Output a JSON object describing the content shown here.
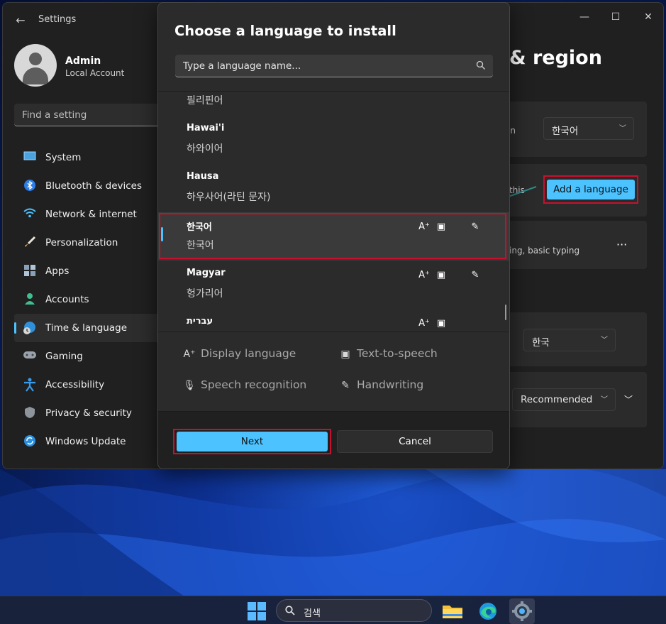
{
  "settings": {
    "app_title": "Settings",
    "profile": {
      "name": "Admin",
      "account_type": "Local Account"
    },
    "search_placeholder": "Find a setting",
    "nav": [
      {
        "label": "System",
        "icon": "monitor-icon"
      },
      {
        "label": "Bluetooth & devices",
        "icon": "bluetooth-icon"
      },
      {
        "label": "Network & internet",
        "icon": "wifi-icon"
      },
      {
        "label": "Personalization",
        "icon": "brush-icon"
      },
      {
        "label": "Apps",
        "icon": "apps-icon"
      },
      {
        "label": "Accounts",
        "icon": "person-icon"
      },
      {
        "label": "Time & language",
        "icon": "globe-clock-icon",
        "active": true
      },
      {
        "label": "Gaming",
        "icon": "gamepad-icon"
      },
      {
        "label": "Accessibility",
        "icon": "accessibility-icon"
      },
      {
        "label": "Privacy & security",
        "icon": "shield-icon"
      },
      {
        "label": "Windows Update",
        "icon": "update-icon"
      }
    ],
    "page_title_fragment": "& region",
    "windows_display_language_value": "한국어",
    "windows_display_language_fragment": "in",
    "preferred_languages_fragment": "this",
    "add_language_label": "Add a language",
    "language_options_fragment": "ing, basic typing",
    "more_options_label": "···",
    "country_region_value": "한국",
    "regional_format_value": "Recommended"
  },
  "dialog": {
    "title": "Choose a language to install",
    "search_placeholder": "Type a language name...",
    "languages": [
      {
        "name": "",
        "localized": "필리핀어"
      },
      {
        "name": "Hawai'i",
        "localized": "하와이어"
      },
      {
        "name": "Hausa",
        "localized": "하우사어(라틴 문자)"
      },
      {
        "name": "한국어",
        "localized": "한국어",
        "selected": true,
        "features": [
          "display-language-icon",
          "text-to-speech-icon",
          "handwriting-icon"
        ]
      },
      {
        "name": "Magyar",
        "localized": "헝가리어",
        "features": [
          "display-language-icon",
          "text-to-speech-icon",
          "handwriting-icon"
        ]
      },
      {
        "name": "עברית",
        "localized": "",
        "features": [
          "display-language-icon",
          "text-to-speech-icon"
        ]
      }
    ],
    "legend": {
      "display_language": "Display language",
      "text_to_speech": "Text-to-speech",
      "speech_recognition": "Speech recognition",
      "handwriting": "Handwriting"
    },
    "next_label": "Next",
    "cancel_label": "Cancel"
  },
  "taskbar": {
    "search_text": "검색",
    "apps": [
      "windows-start-icon",
      "file-explorer-icon",
      "edge-icon",
      "settings-gear-icon"
    ]
  },
  "colors": {
    "accent": "#4cc2ff",
    "highlight_border": "#c8102e",
    "annotation_arrow": "#2a8a8a"
  }
}
